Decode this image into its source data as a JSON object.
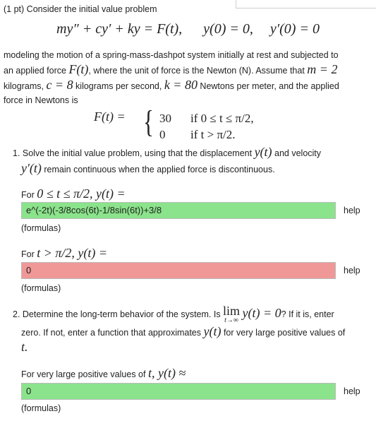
{
  "header": {
    "points": "(1 pt)",
    "intro": "Consider the initial value problem"
  },
  "main_equation": {
    "lhs": "my″ + cy′ + ky = F(t),",
    "ic1": "y(0) = 0,",
    "ic2": "y′(0) = 0"
  },
  "description": {
    "part1": "modeling the motion of a spring-mass-dashpot system initially at rest and subjected to",
    "part2a": "an applied force ",
    "F": "F(t)",
    "part2b": ", where the unit of force is the Newton (N). Assume that ",
    "m_eq": "m = 2",
    "part3a": "kilograms, ",
    "c_eq": "c = 8",
    "part3b": " kilograms per second, ",
    "k_eq": "k = 80",
    "part3c": " Newtons per meter, and the applied",
    "part4": "force in Newtons is"
  },
  "force_definition": {
    "lhs": "F(t) =",
    "case1_value": "30",
    "case1_cond": "if 0 ≤ t ≤ π/2,",
    "case2_value": "0",
    "case2_cond": "if t > π/2."
  },
  "question1": {
    "text_a": "1. Solve the initial value problem, using that the displacement ",
    "y": "y(t)",
    "text_b": " and velocity",
    "yprime": "y′(t)",
    "text_c": " remain continuous when the applied force is discontinuous.",
    "label1_prefix": "For ",
    "label1_math": "0 ≤ t ≤ π/2,  y(t) =",
    "answer1": "e^(-2t)(-3/8cos(6t)-1/8sin(6t))+3/8",
    "label2_prefix": "For ",
    "label2_math": "t > π/2,  y(t) =",
    "answer2": "0"
  },
  "question2": {
    "text_a": "2. Determine the long-term behavior of the system. Is ",
    "lim": "lim",
    "lim_sub": "t→∞",
    "lim_expr": "y(t) = 0",
    "text_b": "? If it is, enter",
    "text_c": "zero. If not, enter a function that approximates ",
    "y": "y(t)",
    "text_d": " for very large positive values of",
    "t": "t.",
    "label_prefix": "For very large positive values of ",
    "label_math": "t, y(t) ≈",
    "answer": "0"
  },
  "links": {
    "help": "help",
    "formulas": "(formulas)"
  },
  "colors": {
    "correct": "#8be38b",
    "incorrect": "#f09797"
  }
}
